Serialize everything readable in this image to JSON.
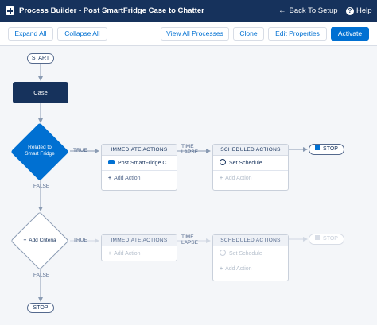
{
  "header": {
    "title": "Process Builder - Post SmartFridge Case to Chatter",
    "back_label": "Back To Setup",
    "help_label": "Help"
  },
  "toolbar": {
    "expand_all": "Expand All",
    "collapse_all": "Collapse All",
    "view_all_processes": "View All Processes",
    "clone": "Clone",
    "edit_properties": "Edit Properties",
    "activate": "Activate"
  },
  "flow": {
    "start": "START",
    "object_node": "Case",
    "criteria_1": {
      "label_line1": "Related to",
      "label_line2": "Smart Fridge",
      "true_label": "TRUE",
      "false_label": "FALSE"
    },
    "criteria_2": {
      "label": "Add Criteria",
      "true_label": "TRUE",
      "false_label": "FALSE"
    },
    "immediate_1": {
      "header": "IMMEDIATE ACTIONS",
      "action": "Post SmartFridge C...",
      "add": "Add Action"
    },
    "time_lapse_1": {
      "line1": "TIME",
      "line2": "LAPSE"
    },
    "scheduled_1": {
      "header": "SCHEDULED ACTIONS",
      "schedule": "Set Schedule",
      "add": "Add Action"
    },
    "stop_1": "STOP",
    "immediate_2": {
      "header": "IMMEDIATE ACTIONS",
      "add": "Add Action"
    },
    "time_lapse_2": {
      "line1": "TIME",
      "line2": "LAPSE"
    },
    "scheduled_2": {
      "header": "SCHEDULED ACTIONS",
      "schedule": "Set Schedule",
      "add": "Add Action"
    },
    "stop_2": "STOP",
    "stop_final": "STOP"
  },
  "colors": {
    "header_bg": "#16325c",
    "brand_blue": "#0070d2",
    "canvas_bg": "#f4f6f9"
  }
}
